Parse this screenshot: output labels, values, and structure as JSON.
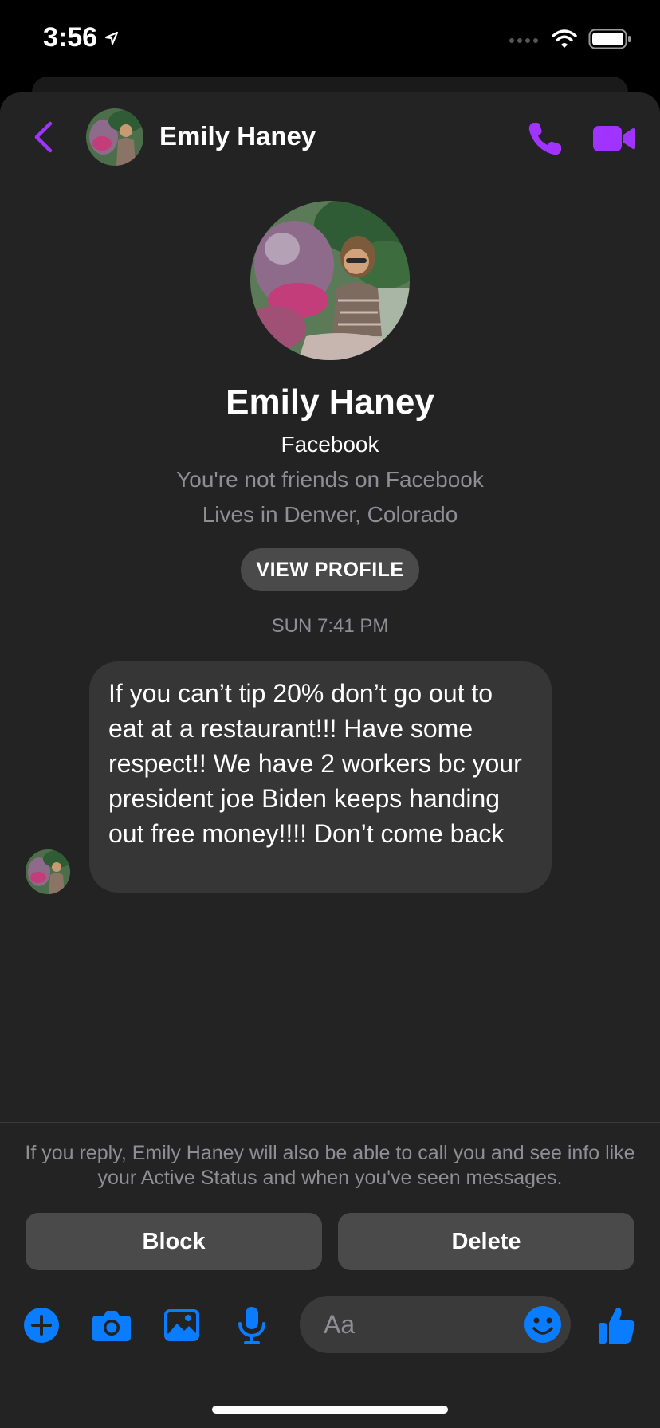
{
  "status_bar": {
    "time": "3:56",
    "icons": [
      "location-arrow-icon",
      "cellular-signal-icon",
      "wifi-icon",
      "battery-icon"
    ]
  },
  "header": {
    "contact_name": "Emily Haney",
    "back_icon": "chevron-left-icon",
    "call_icon": "phone-icon",
    "video_icon": "video-camera-icon"
  },
  "profile": {
    "name": "Emily Haney",
    "source": "Facebook",
    "friend_status": "You're not friends on Facebook",
    "location": "Lives in Denver, Colorado",
    "view_profile_label": "VIEW PROFILE"
  },
  "conversation": {
    "timestamp": "SUN 7:41 PM",
    "messages": [
      {
        "sender": "Emily Haney",
        "text": "If you can’t tip 20% don’t go out to eat at a restaurant!!! Have some respect!! We have 2 workers bc your president joe Biden keeps handing out free money!!!! Don’t come back"
      }
    ]
  },
  "request_panel": {
    "notice": "If you reply, Emily Haney will also be able to call you and see info like your Active Status and when you've seen messages.",
    "block_label": "Block",
    "delete_label": "Delete"
  },
  "composer": {
    "placeholder": "Aa",
    "icons": [
      "plus-icon",
      "camera-icon",
      "photo-icon",
      "microphone-icon",
      "emoji-icon",
      "thumbs-up-icon"
    ]
  },
  "colors": {
    "accent_purple": "#a033ff",
    "accent_blue": "#0a7cff",
    "background": "#232323",
    "bubble": "#363636",
    "secondary_text": "#8e8e93"
  }
}
